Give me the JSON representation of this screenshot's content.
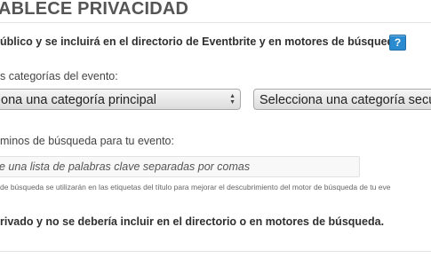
{
  "section": {
    "title": "ABLECE PRIVACIDAD"
  },
  "privacy": {
    "public_option": "úblico y se incluirá en el directorio de Eventbrite y en motores de búsqueda.",
    "help_glyph": "?",
    "private_option": "rivado y no se debería incluir en el directorio o en motores de búsqueda."
  },
  "categories": {
    "label": "s categorías del evento:",
    "primary_select": "ona una categoría principal",
    "secondary_select": "Selecciona una categoría secu"
  },
  "search_terms": {
    "label": "minos de búsqueda para tu evento:",
    "placeholder": "e una lista de palabras clave separadas por comas",
    "hint": "de búsqueda se utilizarán en las etiquetas del título para mejorar el descubrimiento del motor de búsqueda de tu eve"
  },
  "colors": {
    "help_icon_bg": "#2b8bd0",
    "title": "#555555"
  }
}
